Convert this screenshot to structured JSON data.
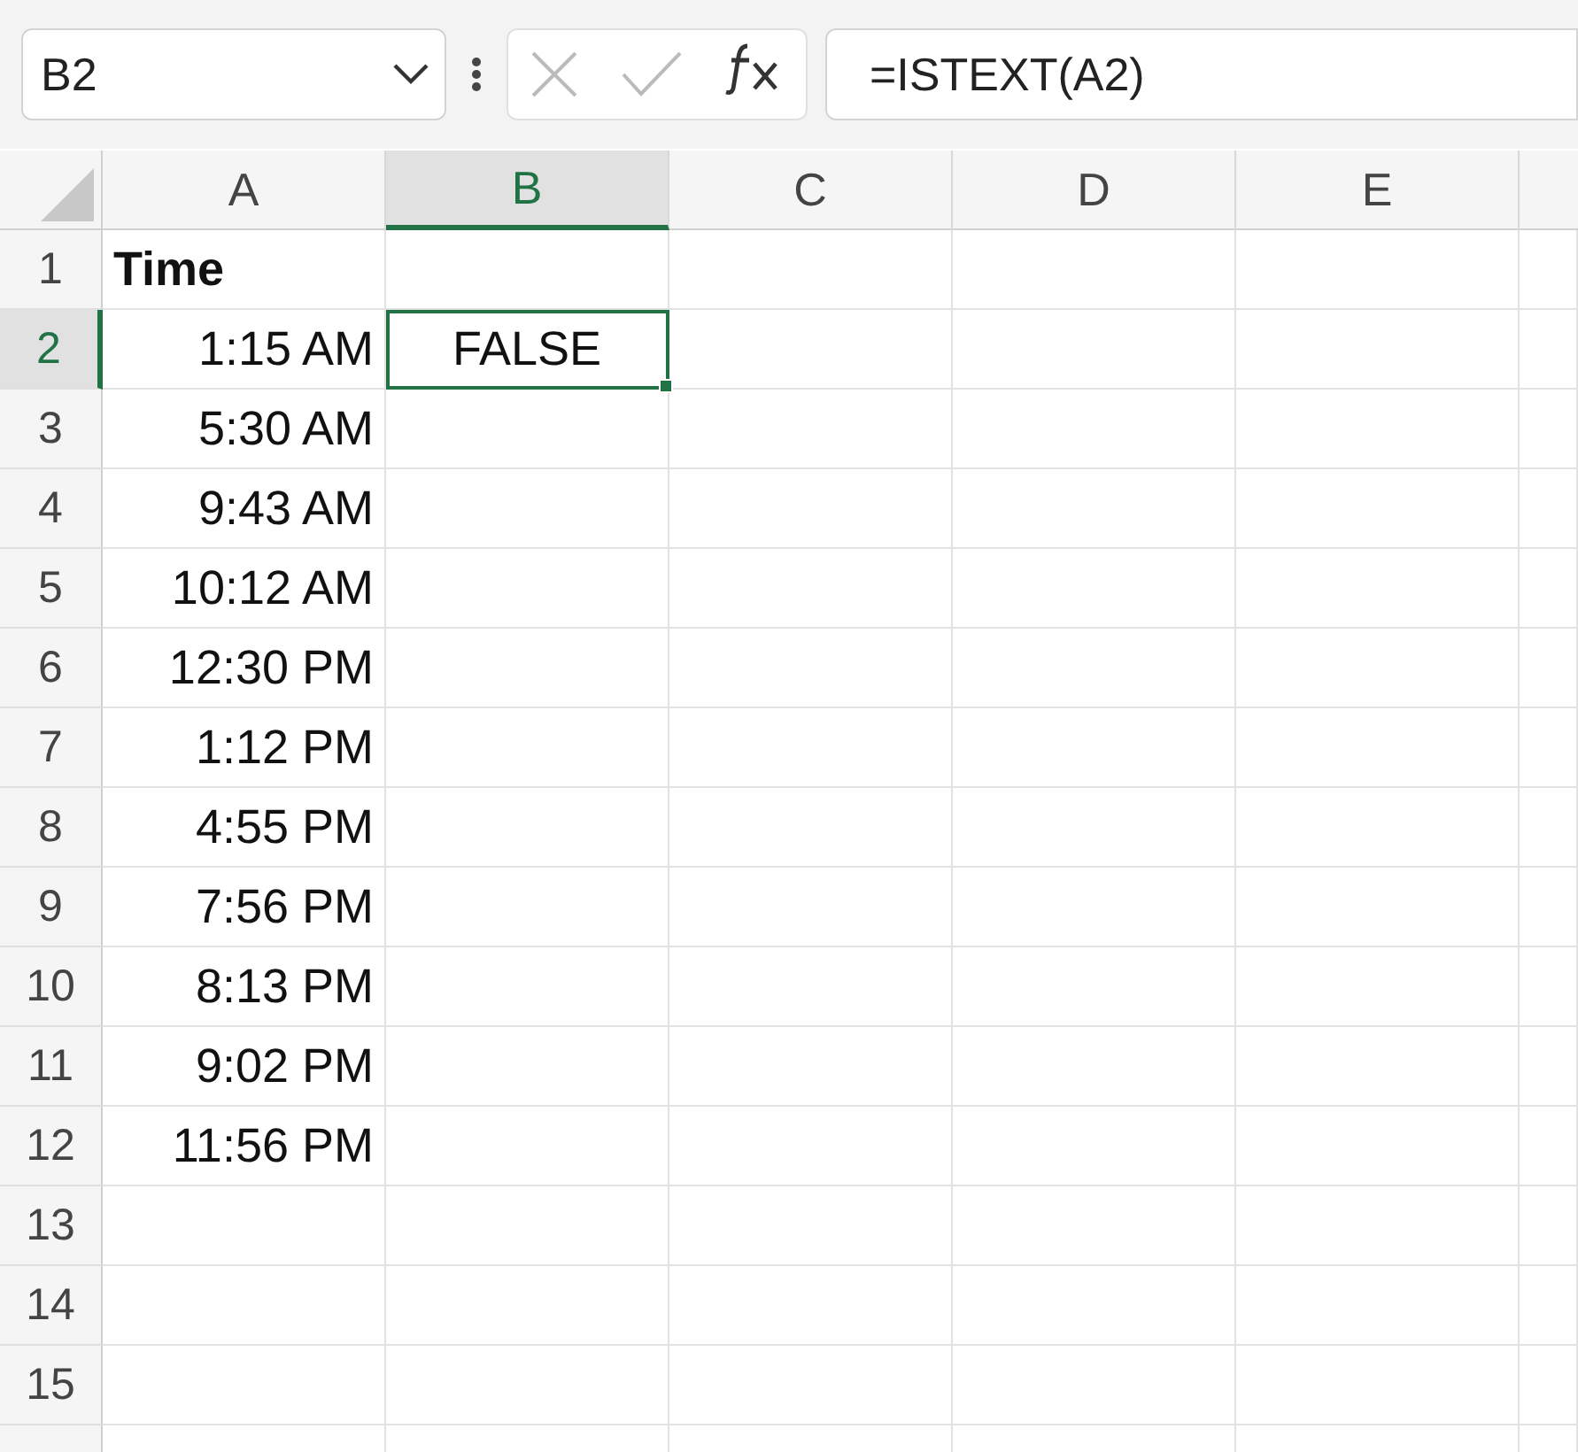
{
  "name_box": {
    "value": "B2"
  },
  "formula_bar": {
    "formula": "=ISTEXT(A2)"
  },
  "columns": [
    {
      "label": "A",
      "selected": false
    },
    {
      "label": "B",
      "selected": true
    },
    {
      "label": "C",
      "selected": false
    },
    {
      "label": "D",
      "selected": false
    },
    {
      "label": "E",
      "selected": false
    }
  ],
  "rows": [
    {
      "label": "1",
      "selected": false,
      "cells": [
        {
          "text": "Time",
          "kind": "text",
          "bold": true,
          "selected": false
        }
      ]
    },
    {
      "label": "2",
      "selected": true,
      "cells": [
        {
          "text": "1:15 AM",
          "kind": "time",
          "bold": false,
          "selected": false
        },
        {
          "text": "FALSE",
          "kind": "boolean",
          "bold": false,
          "selected": true
        }
      ]
    },
    {
      "label": "3",
      "selected": false,
      "cells": [
        {
          "text": "5:30 AM",
          "kind": "time",
          "bold": false,
          "selected": false
        }
      ]
    },
    {
      "label": "4",
      "selected": false,
      "cells": [
        {
          "text": "9:43 AM",
          "kind": "time",
          "bold": false,
          "selected": false
        }
      ]
    },
    {
      "label": "5",
      "selected": false,
      "cells": [
        {
          "text": "10:12 AM",
          "kind": "time",
          "bold": false,
          "selected": false
        }
      ]
    },
    {
      "label": "6",
      "selected": false,
      "cells": [
        {
          "text": "12:30 PM",
          "kind": "time",
          "bold": false,
          "selected": false
        }
      ]
    },
    {
      "label": "7",
      "selected": false,
      "cells": [
        {
          "text": "1:12 PM",
          "kind": "time",
          "bold": false,
          "selected": false
        }
      ]
    },
    {
      "label": "8",
      "selected": false,
      "cells": [
        {
          "text": "4:55 PM",
          "kind": "time",
          "bold": false,
          "selected": false
        }
      ]
    },
    {
      "label": "9",
      "selected": false,
      "cells": [
        {
          "text": "7:56 PM",
          "kind": "time",
          "bold": false,
          "selected": false
        }
      ]
    },
    {
      "label": "10",
      "selected": false,
      "cells": [
        {
          "text": "8:13 PM",
          "kind": "time",
          "bold": false,
          "selected": false
        }
      ]
    },
    {
      "label": "11",
      "selected": false,
      "cells": [
        {
          "text": "9:02 PM",
          "kind": "time",
          "bold": false,
          "selected": false
        }
      ]
    },
    {
      "label": "12",
      "selected": false,
      "cells": [
        {
          "text": "11:56 PM",
          "kind": "time",
          "bold": false,
          "selected": false
        }
      ]
    },
    {
      "label": "13",
      "selected": false,
      "cells": []
    },
    {
      "label": "14",
      "selected": false,
      "cells": []
    },
    {
      "label": "15",
      "selected": false,
      "cells": []
    }
  ]
}
